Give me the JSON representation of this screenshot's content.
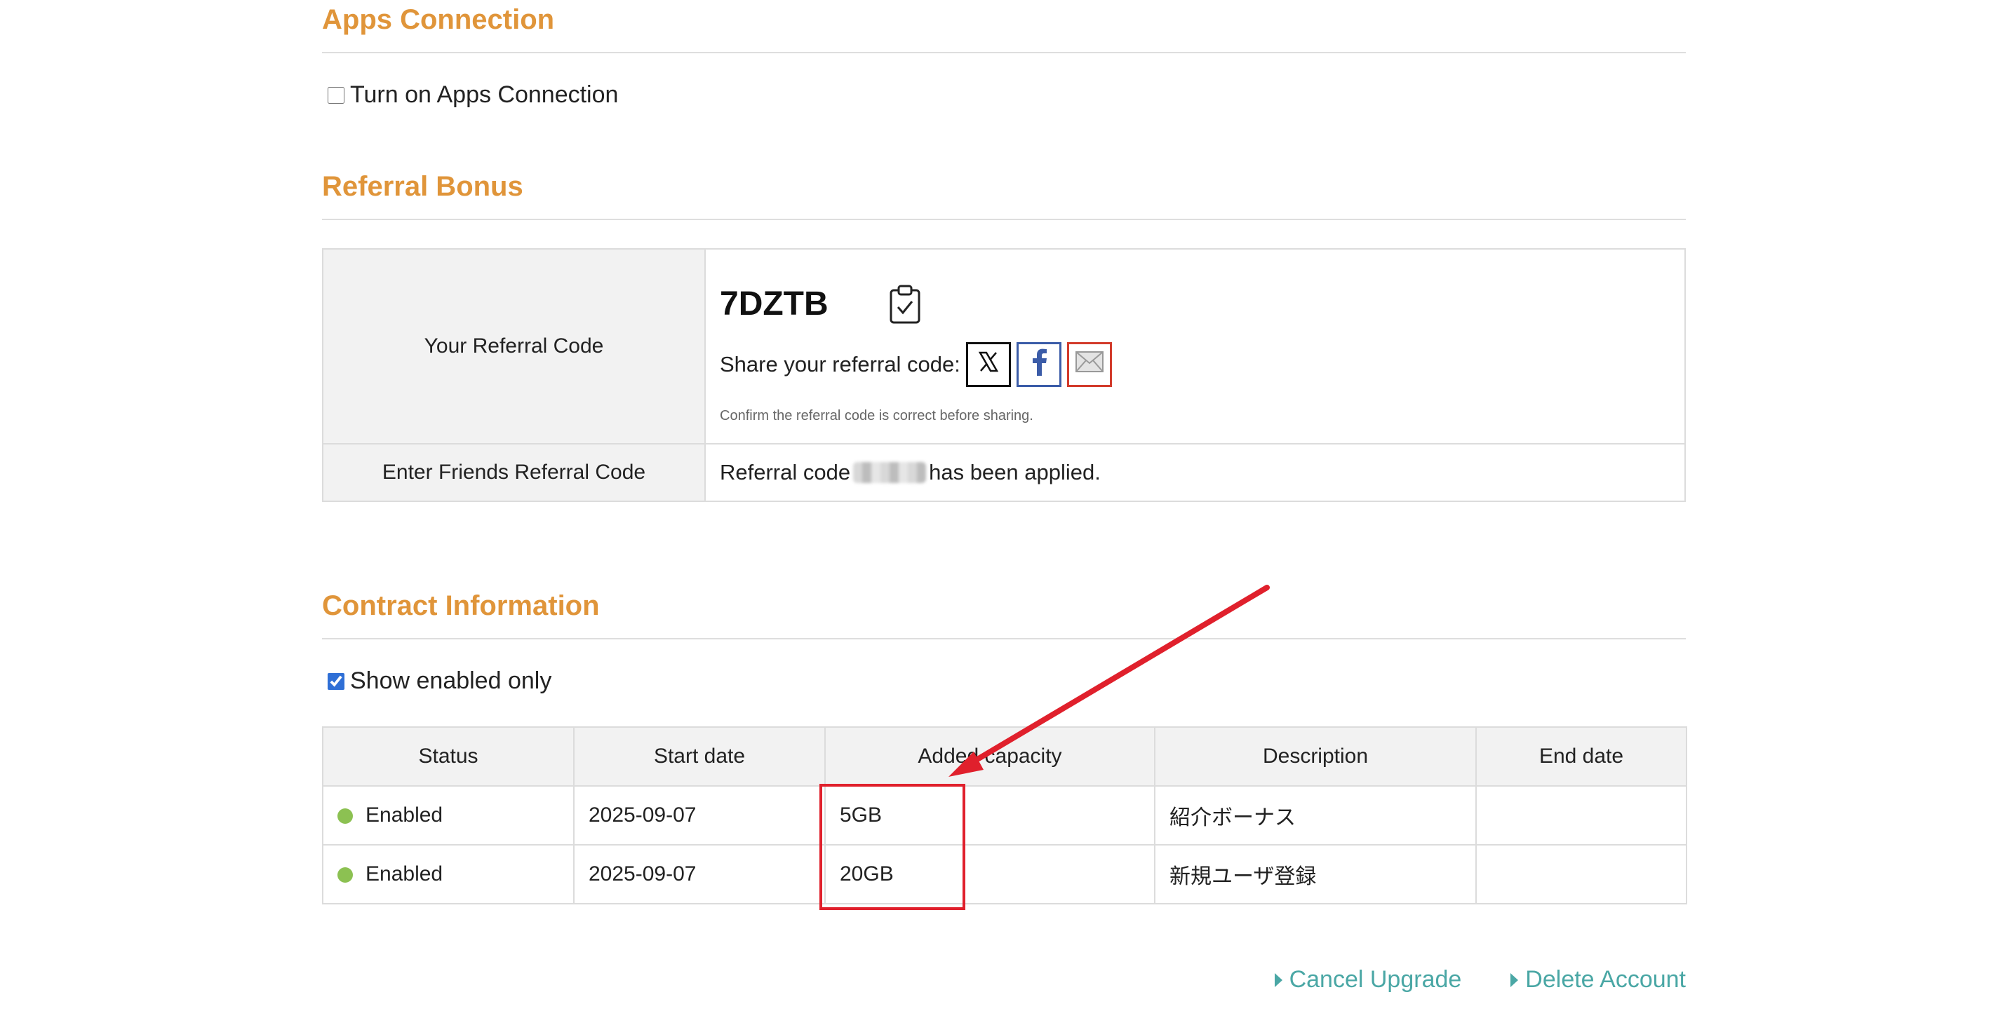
{
  "apps_connection": {
    "title": "Apps Connection",
    "checkbox_label": "Turn on Apps Connection",
    "checked": false
  },
  "referral": {
    "title": "Referral Bonus",
    "your_code_label": "Your Referral Code",
    "code": "7DZTB",
    "share_label": "Share your referral code:",
    "share_buttons": [
      "x-icon",
      "facebook-icon",
      "mail-icon"
    ],
    "confirm_note": "Confirm the referral code is correct before sharing.",
    "enter_friend_label": "Enter Friends Referral Code",
    "applied_prefix": "Referral code",
    "applied_suffix": "has been applied."
  },
  "contract": {
    "title": "Contract Information",
    "show_enabled_label": "Show enabled only",
    "show_enabled_checked": true,
    "headers": [
      "Status",
      "Start date",
      "Added capacity",
      "Description",
      "End date"
    ],
    "rows": [
      {
        "status": "Enabled",
        "start": "2025-09-07",
        "capacity": "5GB",
        "description": "紹介ボーナス",
        "end": ""
      },
      {
        "status": "Enabled",
        "start": "2025-09-07",
        "capacity": "20GB",
        "description": "新規ユーザ登録",
        "end": ""
      }
    ]
  },
  "footer": {
    "cancel_upgrade": "Cancel Upgrade",
    "delete_account": "Delete Account"
  },
  "colors": {
    "section_title": "#e0953a",
    "link": "#4aa7a5",
    "status_enabled": "#8cc152",
    "annotation": "#e0202c"
  }
}
